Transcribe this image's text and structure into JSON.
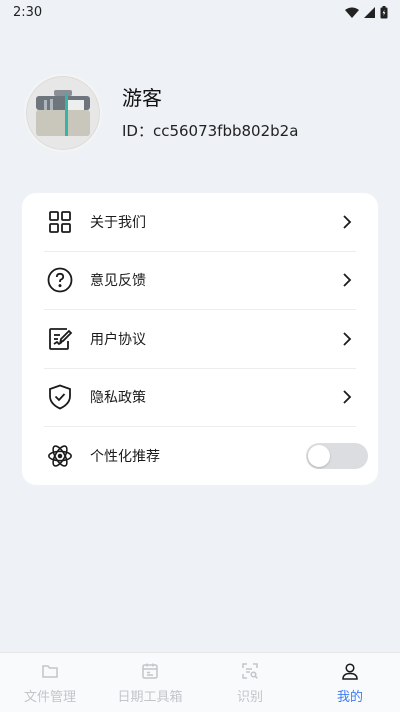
{
  "status_bar": {
    "time": "2:30"
  },
  "profile": {
    "name": "游客",
    "id_text": "ID：cc56073fbb802b2a"
  },
  "menu": [
    {
      "label": "关于我们",
      "icon": "grid-icon"
    },
    {
      "label": "意见反馈",
      "icon": "question-icon"
    },
    {
      "label": "用户协议",
      "icon": "document-edit-icon"
    },
    {
      "label": "隐私政策",
      "icon": "shield-check-icon"
    },
    {
      "label": "个性化推荐",
      "icon": "atom-icon",
      "toggle": false
    }
  ],
  "tabs": [
    {
      "label": "文件管理",
      "icon": "folder-icon",
      "active": false
    },
    {
      "label": "日期工具箱",
      "icon": "calendar-icon",
      "active": false
    },
    {
      "label": "识别",
      "icon": "scan-icon",
      "active": false
    },
    {
      "label": "我的",
      "icon": "user-icon",
      "active": true
    }
  ],
  "colors": {
    "accent": "#3d7df5",
    "background": "#eef1f5",
    "card": "#ffffff",
    "inactive_tab": "#c2c5ca"
  }
}
